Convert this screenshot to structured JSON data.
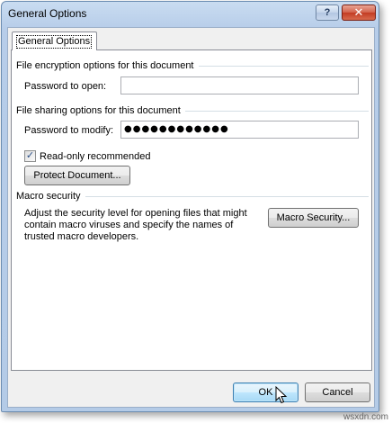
{
  "window": {
    "title": "General Options",
    "help_label": "?",
    "close_label": "✕"
  },
  "tab": {
    "label": "General Options"
  },
  "encryption": {
    "header": "File encryption options for this document",
    "password_open_label": "Password to open:",
    "password_open_value": ""
  },
  "sharing": {
    "header": "File sharing options for this document",
    "password_modify_label": "Password to modify:",
    "password_modify_value": "●●●●●●●●●●●●",
    "readonly_label": "Read-only recommended",
    "readonly_checked": "✓",
    "protect_button": "Protect Document..."
  },
  "macro": {
    "header": "Macro security",
    "description_line1": "Adjust the security level for opening files that might",
    "description_line2": "contain macro viruses and specify the names of",
    "description_line3": "trusted macro developers.",
    "button": "Macro Security..."
  },
  "footer": {
    "ok": "OK",
    "cancel": "Cancel"
  },
  "watermark": "wsxdn.com"
}
